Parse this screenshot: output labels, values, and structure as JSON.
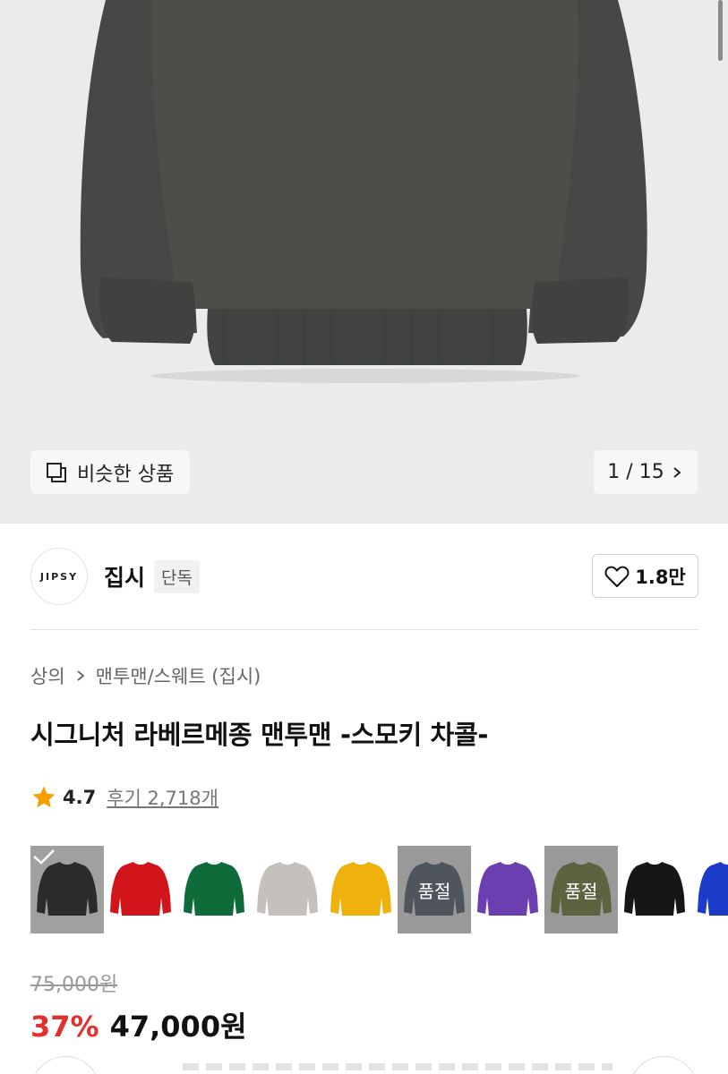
{
  "colors": {
    "garment": "#4a4d48",
    "sale_red": "#e52e2e",
    "star": "#f5a000"
  },
  "hero": {
    "similar_label": "비슷한 상품",
    "pager": "1 / 15"
  },
  "brand": {
    "logo_text": "JIPSY",
    "name": "집시",
    "badge": "단독",
    "likes": "1.8만"
  },
  "product": {
    "breadcrumb": [
      "상의",
      "맨투맨/스웨트 (집시)"
    ],
    "title": "시그니처 라베르메종 맨투맨 -스모키 차콜-",
    "rating": "4.7",
    "reviews": "후기 2,718개"
  },
  "swatches": [
    {
      "color": "#1e1e1e",
      "state": "selected"
    },
    {
      "color": "#d2141b",
      "state": ""
    },
    {
      "color": "#0f6b3a",
      "state": ""
    },
    {
      "color": "#c4c1bc",
      "state": ""
    },
    {
      "color": "#efb10c",
      "state": ""
    },
    {
      "color": "#4e5c6d",
      "state": "soldout",
      "label": "품절"
    },
    {
      "color": "#6c3fb1",
      "state": ""
    },
    {
      "color": "#6f7a2a",
      "state": "soldout",
      "label": "품절"
    },
    {
      "color": "#161616",
      "state": ""
    },
    {
      "color": "#1d3bc9",
      "state": ""
    }
  ],
  "price": {
    "original": "75,000원",
    "discount": "37%",
    "sale": "47,000원"
  }
}
